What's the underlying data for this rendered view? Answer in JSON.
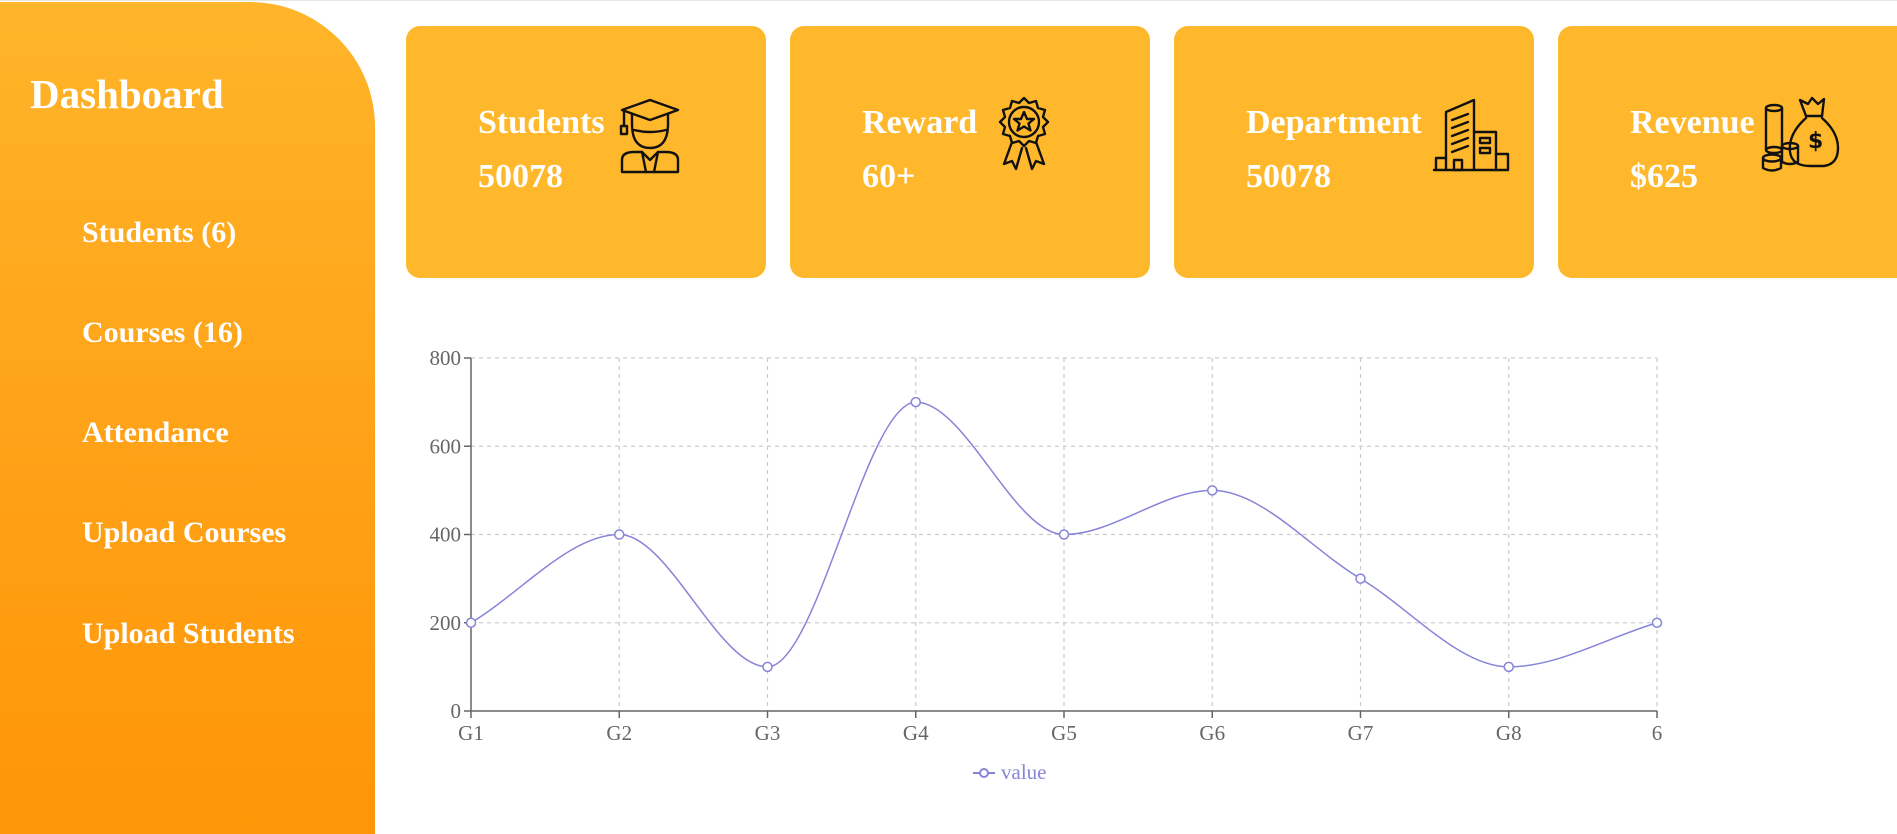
{
  "sidebar": {
    "title": "Dashboard",
    "items": [
      {
        "label": "Students (6)"
      },
      {
        "label": "Courses (16)"
      },
      {
        "label": "Attendance"
      },
      {
        "label": "Upload Courses"
      },
      {
        "label": "Upload Students"
      }
    ]
  },
  "cards": [
    {
      "label": "Students",
      "value": "50078",
      "icon": "graduate-student-icon"
    },
    {
      "label": "Reward",
      "value": "60+",
      "icon": "award-badge-icon"
    },
    {
      "label": "Department",
      "value": "50078",
      "icon": "building-icon"
    },
    {
      "label": "Revenue",
      "value": "$625",
      "icon": "money-bag-icon"
    }
  ],
  "colors": {
    "sidebar_top": "#ffb52a",
    "sidebar_bottom": "#ff9508",
    "card": "#ffb82c",
    "line": "#8884d8"
  },
  "chart_data": {
    "type": "line",
    "categories": [
      "G1",
      "G2",
      "G3",
      "G4",
      "G5",
      "G6",
      "G7",
      "G8",
      "6"
    ],
    "series": [
      {
        "name": "value",
        "values": [
          200,
          400,
          100,
          700,
          400,
          500,
          300,
          100,
          200
        ]
      }
    ],
    "y_ticks": [
      0,
      200,
      400,
      600,
      800
    ],
    "ylim": [
      0,
      800
    ],
    "grid": true,
    "legend": "bottom-center",
    "title": "",
    "xlabel": "",
    "ylabel": ""
  }
}
